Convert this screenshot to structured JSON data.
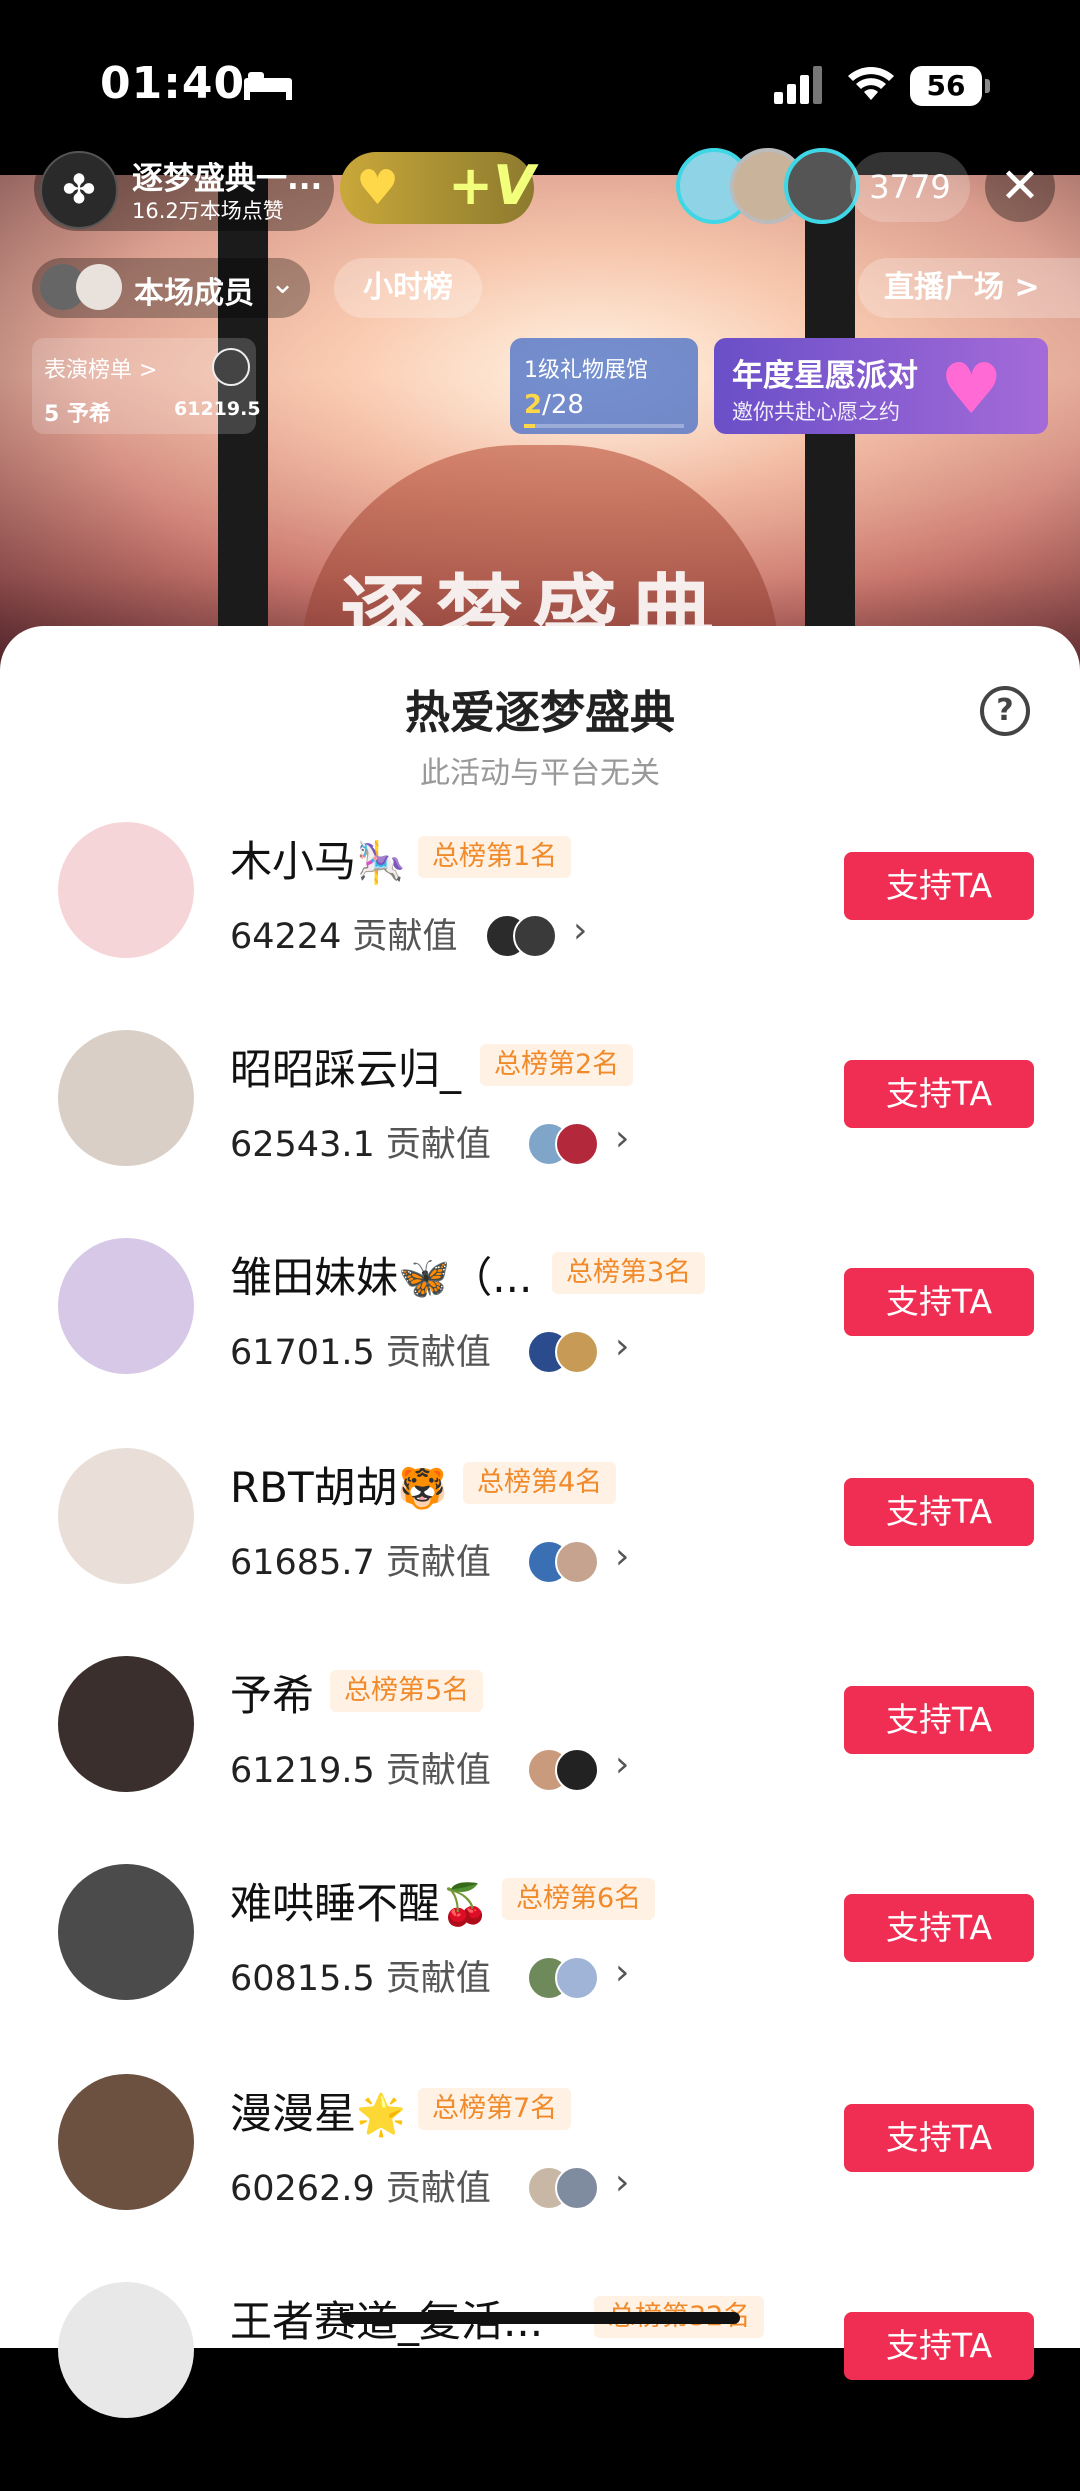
{
  "status": {
    "time": "01:40",
    "battery": "56"
  },
  "live": {
    "host_name": "逐梦盛典一...",
    "host_likes": "16.2万本场点赞",
    "viewer_count": "3779",
    "members_label": "本场成员",
    "hourly_label": "小时榜",
    "square_label": "直播广场 >",
    "perf_title": "表演榜单 >",
    "perf_name": "5 予希",
    "perf_score": "61219.5",
    "gift_hall_title": "1级礼物展馆",
    "gift_hall_current": "2",
    "gift_hall_total": "/28",
    "gift_hall_progress": 0.07,
    "party_title": "年度星愿派对",
    "party_subtitle": "邀你共赴心愿之约",
    "banner_art_text": "逐梦盛典"
  },
  "sheet": {
    "title": "热爱逐梦盛典",
    "subtitle": "此活动与平台无关",
    "help_label": "?",
    "score_label": "贡献值",
    "button_label": "支持TA",
    "items": [
      {
        "name": "木小马",
        "emoji": "🎠",
        "rank": "总榜第1名",
        "score": "64224",
        "avatar_color": "#f6d5d8",
        "sup": [
          "#2b2b2b",
          "#3a3a3a"
        ]
      },
      {
        "name": "昭昭踩云归_",
        "emoji": "",
        "rank": "总榜第2名",
        "score": "62543.1",
        "avatar_color": "#d9cfc6",
        "sup": [
          "#7fa6c9",
          "#b3283a"
        ]
      },
      {
        "name": "雏田妹妹🦋（...",
        "emoji": "",
        "rank": "总榜第3名",
        "score": "61701.5",
        "avatar_color": "#d6c8e6",
        "sup": [
          "#2a4c8c",
          "#c79a55"
        ]
      },
      {
        "name": "RBT胡胡",
        "emoji": "🐯",
        "rank": "总榜第4名",
        "score": "61685.7",
        "avatar_color": "#e9dfd8",
        "sup": [
          "#3a6fb3",
          "#c6a38f"
        ]
      },
      {
        "name": "予希",
        "emoji": "",
        "rank": "总榜第5名",
        "score": "61219.5",
        "avatar_color": "#3a2f2c",
        "sup": [
          "#c99b7c",
          "#222"
        ]
      },
      {
        "name": "难哄睡不醒",
        "emoji": "🍒",
        "rank": "总榜第6名",
        "score": "60815.5",
        "avatar_color": "#4b4b4b",
        "sup": [
          "#6e8a5a",
          "#9fb4d6"
        ]
      },
      {
        "name": "漫漫星",
        "emoji": "🌟",
        "rank": "总榜第7名",
        "score": "60262.9",
        "avatar_color": "#6c5040",
        "sup": [
          "#c9b7a5",
          "#7f8b9e"
        ]
      },
      {
        "name": "王者赛道_复活...",
        "emoji": "",
        "rank": "总榜第32名",
        "score": "",
        "avatar_color": "#e8e8e8",
        "sup": []
      }
    ]
  }
}
